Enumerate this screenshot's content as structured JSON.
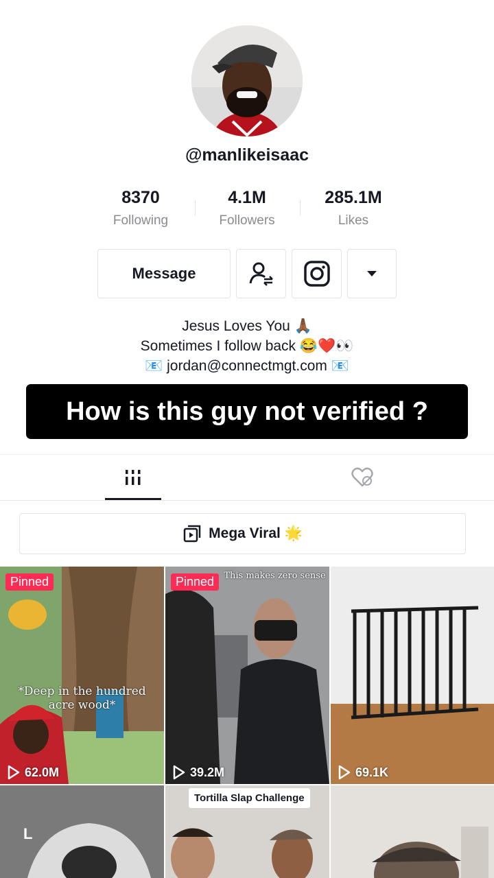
{
  "profile": {
    "username": "@manlikeisaac",
    "stats": [
      {
        "value": "8370",
        "label": "Following"
      },
      {
        "value": "4.1M",
        "label": "Followers"
      },
      {
        "value": "285.1M",
        "label": "Likes"
      }
    ],
    "message_label": "Message",
    "bio": [
      "Jesus Loves You 🙏🏾",
      "Sometimes I follow back 😂❤️👀",
      "📧 jordan@connectmgt.com 📧"
    ]
  },
  "overlay_caption": "How is this guy not verified ?",
  "tabs": {
    "videos_icon": "grid-icon",
    "liked_icon": "liked-hidden-icon"
  },
  "playlist": {
    "label": "Mega Viral 🌟",
    "icon": "playlist-icon"
  },
  "videos": [
    {
      "pinned": "Pinned",
      "views": "62.0M",
      "caption": "*Deep in the hundred acre wood*"
    },
    {
      "pinned": "Pinned",
      "views": "39.2M",
      "caption": "This makes zero sense"
    },
    {
      "pinned": "",
      "views": "69.1K",
      "caption": ""
    },
    {
      "pinned": "",
      "views": "",
      "caption": "L"
    },
    {
      "pinned": "",
      "views": "",
      "caption": "Tortilla Slap Challenge"
    },
    {
      "pinned": "",
      "views": "",
      "caption": ""
    }
  ],
  "colors": {
    "accent": "#fe2c55",
    "text": "#161823",
    "muted": "#8a8b91",
    "border": "#e3e3e4"
  }
}
